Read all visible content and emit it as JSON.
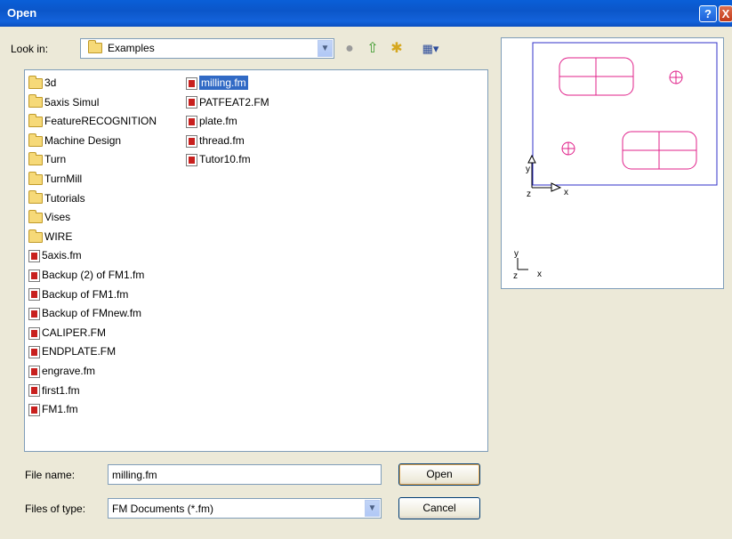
{
  "window": {
    "title": "Open",
    "help_label": "?",
    "close_label": "X"
  },
  "toolbar": {
    "look_in_label": "Look in:",
    "look_in_value": "Examples",
    "icons": [
      "folder-icon",
      "back-icon",
      "up-folder-icon",
      "new-folder-icon",
      "view-menu-icon"
    ]
  },
  "files": [
    {
      "name": "3d",
      "type": "folder"
    },
    {
      "name": "5axis Simul",
      "type": "folder"
    },
    {
      "name": "FeatureRECOGNITION",
      "type": "folder"
    },
    {
      "name": "Machine Design",
      "type": "folder"
    },
    {
      "name": "Turn",
      "type": "folder"
    },
    {
      "name": "TurnMill",
      "type": "folder"
    },
    {
      "name": "Tutorials",
      "type": "folder"
    },
    {
      "name": "Vises",
      "type": "folder"
    },
    {
      "name": "WIRE",
      "type": "folder"
    },
    {
      "name": "5axis.fm",
      "type": "fm"
    },
    {
      "name": "Backup (2) of FM1.fm",
      "type": "fm"
    },
    {
      "name": "Backup of FM1.fm",
      "type": "fm"
    },
    {
      "name": "Backup of FMnew.fm",
      "type": "fm"
    },
    {
      "name": "CALIPER.FM",
      "type": "fm"
    },
    {
      "name": "ENDPLATE.FM",
      "type": "fm"
    },
    {
      "name": "engrave.fm",
      "type": "fm"
    },
    {
      "name": "first1.fm",
      "type": "fm"
    },
    {
      "name": "FM1.fm",
      "type": "fm"
    },
    {
      "name": "milling.fm",
      "type": "fm",
      "selected": true
    },
    {
      "name": "PATFEAT2.FM",
      "type": "fm"
    },
    {
      "name": "plate.fm",
      "type": "fm"
    },
    {
      "name": "thread.fm",
      "type": "fm"
    },
    {
      "name": "Tutor10.fm",
      "type": "fm"
    }
  ],
  "preview": {
    "axis_x": "x",
    "axis_y": "y",
    "axis_z": "z",
    "colors": {
      "part": "#e0208a",
      "stock": "#3030c8",
      "axis": "#000000"
    }
  },
  "form": {
    "file_name_label": "File name:",
    "file_name_value": "milling.fm",
    "file_type_label": "Files of type:",
    "file_type_value": "FM Documents (*.fm)",
    "open_button": "Open",
    "cancel_button": "Cancel"
  }
}
